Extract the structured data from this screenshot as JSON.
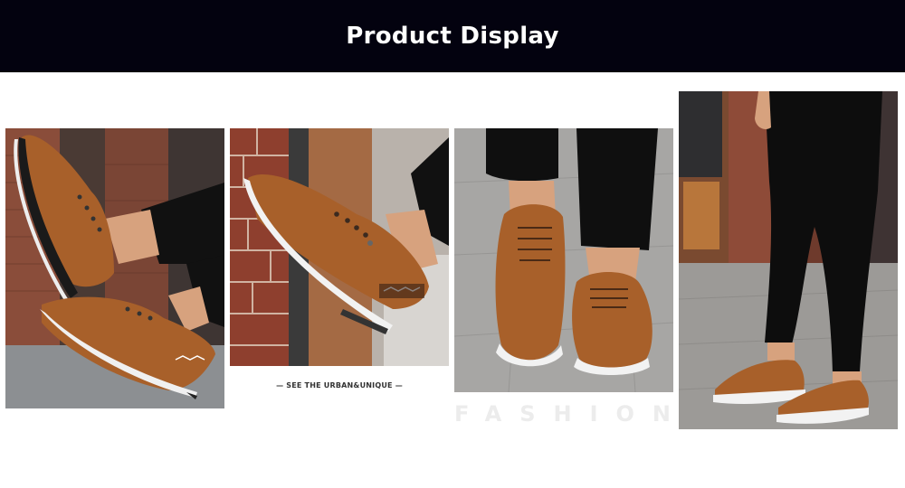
{
  "header": {
    "title": "Product Display"
  },
  "captions": {
    "tagline": "— SEE THE URBAN&UNIQUE —",
    "fashion": "FASHION"
  },
  "colors": {
    "header_bg": "#03020f",
    "shoe_brown": "#a8602a",
    "sole_white": "#f2f2f2"
  }
}
